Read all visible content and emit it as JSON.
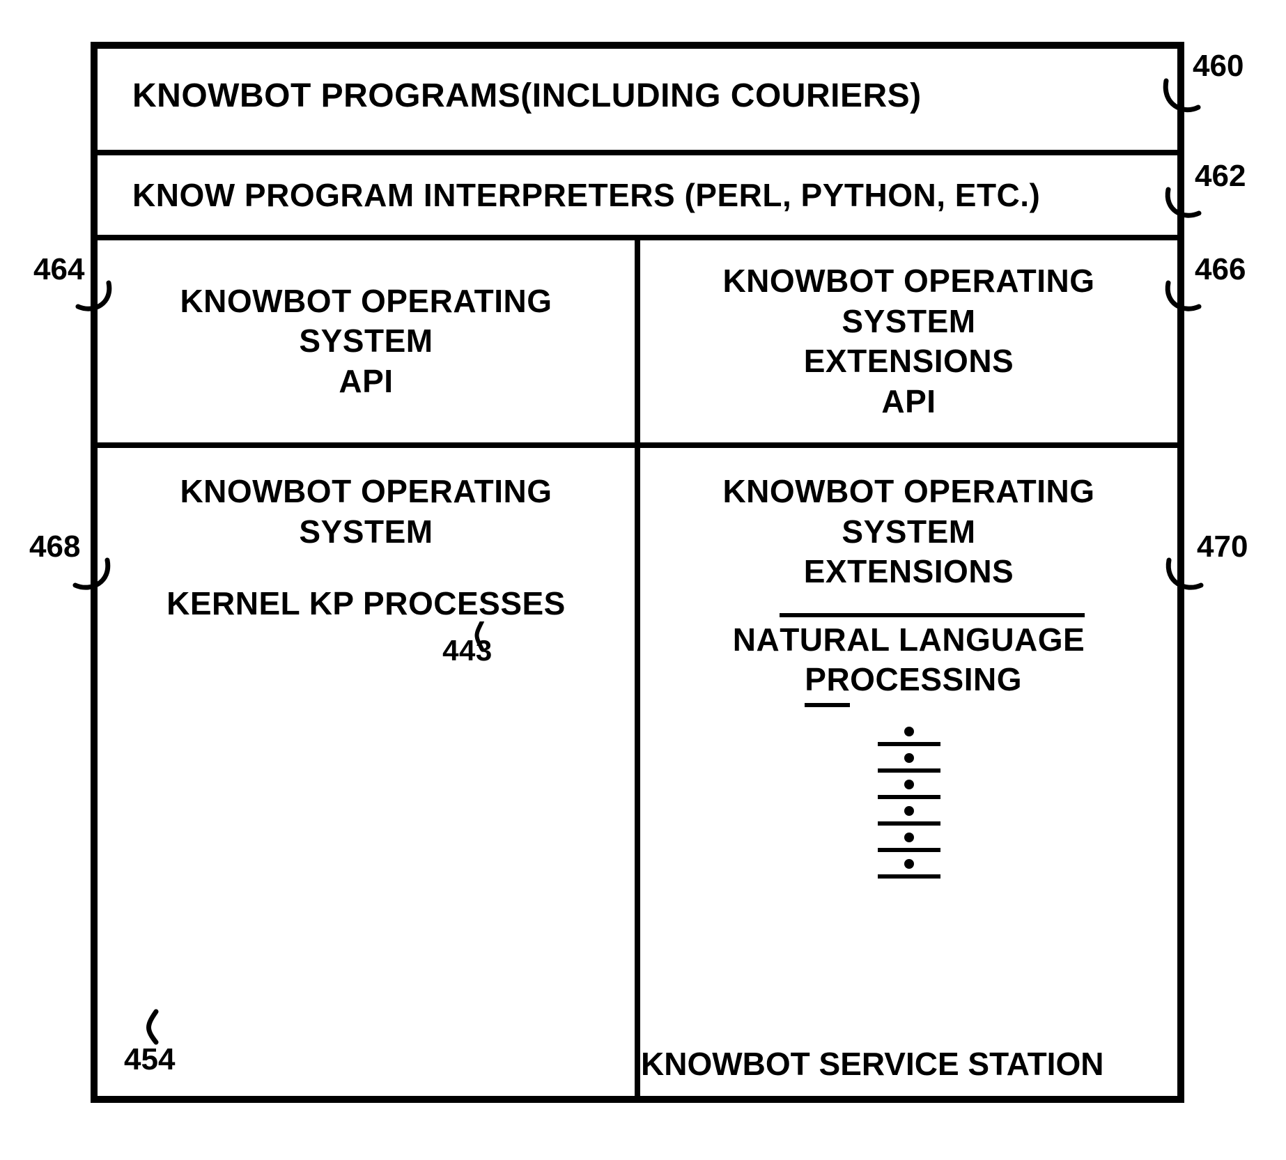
{
  "rows": {
    "programs": "KNOWBOT PROGRAMS(INCLUDING COURIERS)",
    "interpreters": "KNOW PROGRAM INTERPRETERS (PERL, PYTHON, ETC.)",
    "api_left_l1": "KNOWBOT OPERATING SYSTEM",
    "api_left_l2": "API",
    "api_right_l1": "KNOWBOT OPERATING SYSTEM",
    "api_right_l2": "EXTENSIONS",
    "api_right_l3": "API",
    "kernel_l1": "KNOWBOT OPERATING SYSTEM",
    "kernel_l2": "KERNEL",
    "kp_processes": "KP PROCESSES",
    "ext_l1": "KNOWBOT OPERATING SYSTEM",
    "ext_l2": "EXTENSIONS",
    "nlp_top": "TURAL LANGUAGE",
    "nlp_top_prefix": "NA",
    "nlp_bottom_prefix": " ",
    "nlp_bottom": "PR",
    "nlp_bottom_suffix": "OCESSING"
  },
  "refs": {
    "r460": "460",
    "r462": "462",
    "r464": "464",
    "r466": "466",
    "r468": "468",
    "r470": "470",
    "r443": "443",
    "r454": "454"
  },
  "caption": "KNOWBOT SERVICE STATION",
  "dots_count": 6
}
